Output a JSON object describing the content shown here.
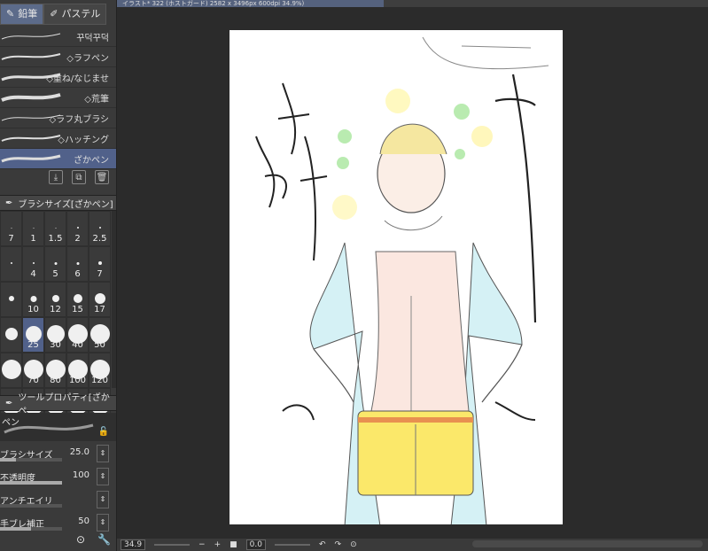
{
  "left_panel": {
    "tabs": [
      {
        "label": "鉛筆",
        "icon": "pencil-icon",
        "active": true
      },
      {
        "label": "パステル",
        "icon": "pastel-icon",
        "active": false
      }
    ],
    "brushes": [
      {
        "name": "꾸덕꾸덕",
        "selected": false
      },
      {
        "name": "◇ラフペン",
        "selected": false
      },
      {
        "name": "◇重ね/なじませ",
        "selected": false
      },
      {
        "name": "◇荒筆",
        "selected": false
      },
      {
        "name": "◇ラフ丸ブラシ",
        "selected": false
      },
      {
        "name": "◇ハッチング",
        "selected": false
      },
      {
        "name": "ざかペン",
        "selected": true
      }
    ],
    "brush_size_title": "ブラシサイズ[ざかペン]",
    "sizes": [
      {
        "v": "7",
        "d": 1
      },
      {
        "v": "1",
        "d": 1
      },
      {
        "v": "1.5",
        "d": 1
      },
      {
        "v": "2",
        "d": 2
      },
      {
        "v": "2.5",
        "d": 2
      },
      {
        "v": "",
        "d": 2
      },
      {
        "v": "4",
        "d": 2
      },
      {
        "v": "5",
        "d": 3
      },
      {
        "v": "6",
        "d": 3
      },
      {
        "v": "7",
        "d": 4
      },
      {
        "v": "",
        "d": 6
      },
      {
        "v": "10",
        "d": 7
      },
      {
        "v": "12",
        "d": 8
      },
      {
        "v": "15",
        "d": 10
      },
      {
        "v": "17",
        "d": 12
      },
      {
        "v": "",
        "d": 14
      },
      {
        "v": "25",
        "d": 18,
        "sel": true
      },
      {
        "v": "30",
        "d": 20
      },
      {
        "v": "40",
        "d": 22
      },
      {
        "v": "50",
        "d": 22
      },
      {
        "v": "",
        "d": 22
      },
      {
        "v": "70",
        "d": 22
      },
      {
        "v": "80",
        "d": 22
      },
      {
        "v": "100",
        "d": 22
      },
      {
        "v": "120",
        "d": 22
      },
      {
        "v": "",
        "d": 22
      },
      {
        "v": "",
        "d": 22
      },
      {
        "v": "",
        "d": 22
      },
      {
        "v": "",
        "d": 22
      },
      {
        "v": "",
        "d": 22
      }
    ],
    "tool_property_title": "ツールプロパティ[ざかペ",
    "tool_name": "ペン",
    "props": [
      {
        "key": "ブラシサイズ",
        "value": "25.0",
        "fill": 0.25
      },
      {
        "key": "不透明度",
        "value": "100",
        "fill": 1.0
      },
      {
        "key": "アンチエイリ",
        "value": "",
        "fill": 0
      },
      {
        "key": "手ブレ補正",
        "value": "50",
        "fill": 0.5
      }
    ]
  },
  "canvas": {
    "doc_tab": "イラスト* 322 (ホストガード) 2582 x 3496px 600dpi 34.9%)",
    "zoom": "34.9",
    "rotation": "0.0"
  },
  "colors": {
    "panel": "#3a3a3a",
    "selected": "#51618a",
    "canvas_bg": "#2b2b2b"
  }
}
